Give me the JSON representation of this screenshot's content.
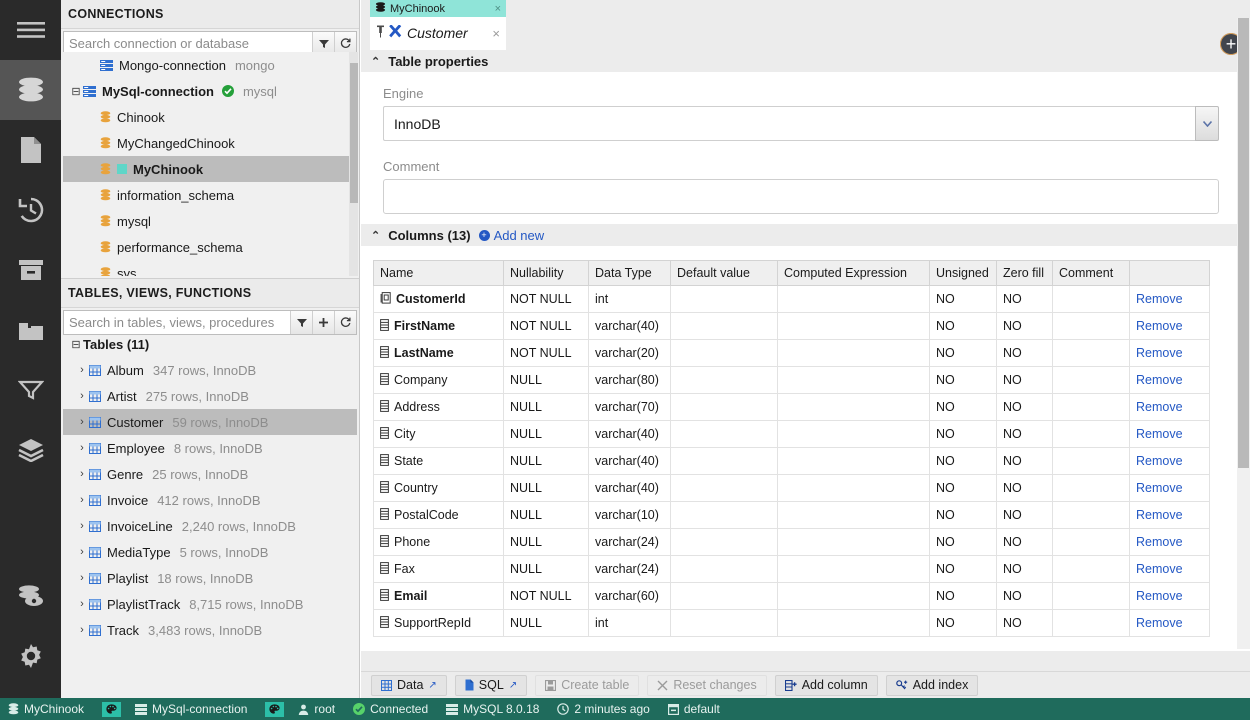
{
  "rail": {
    "items": [
      {
        "name": "menu-icon",
        "label": "Menu",
        "active": false
      },
      {
        "name": "database-icon",
        "label": "Databases",
        "active": true
      },
      {
        "name": "file-icon",
        "label": "Files",
        "active": false
      },
      {
        "name": "history-icon",
        "label": "History",
        "active": false
      },
      {
        "name": "archive-icon",
        "label": "Archive",
        "active": false
      },
      {
        "name": "folder-icon",
        "label": "Saved",
        "active": false
      },
      {
        "name": "funnel-icon",
        "label": "Filters",
        "active": false
      },
      {
        "name": "layers-icon",
        "label": "Layers",
        "active": false
      },
      {
        "name": "db-view-icon",
        "label": "Data preview",
        "active": false
      },
      {
        "name": "gear-icon",
        "label": "Settings",
        "active": false
      }
    ]
  },
  "connections": {
    "title": "CONNECTIONS",
    "search_placeholder": "Search connection or database",
    "search_value": "",
    "filter_icon": "funnel-icon",
    "refresh_icon": "refresh-icon",
    "tree": [
      {
        "indent": 1,
        "twist": "",
        "icon": "server-icon",
        "label": "Mongo-connection",
        "meta": "mongo",
        "bold": false,
        "selected": false,
        "swatch": false
      },
      {
        "indent": 0,
        "twist": "⊟",
        "icon": "server-icon",
        "label": "MySql-connection",
        "meta": "mysql",
        "bold": true,
        "selected": false,
        "swatch": false,
        "status": "connected-check-icon"
      },
      {
        "indent": 1,
        "twist": "",
        "icon": "database-icon",
        "label": "Chinook",
        "meta": "",
        "bold": false,
        "selected": false,
        "swatch": false
      },
      {
        "indent": 1,
        "twist": "",
        "icon": "database-icon",
        "label": "MyChangedChinook",
        "meta": "",
        "bold": false,
        "selected": false,
        "swatch": false
      },
      {
        "indent": 1,
        "twist": "",
        "icon": "database-icon",
        "label": "MyChinook",
        "meta": "",
        "bold": true,
        "selected": true,
        "swatch": true
      },
      {
        "indent": 1,
        "twist": "",
        "icon": "database-icon",
        "label": "information_schema",
        "meta": "",
        "bold": false,
        "selected": false,
        "swatch": false
      },
      {
        "indent": 1,
        "twist": "",
        "icon": "database-icon",
        "label": "mysql",
        "meta": "",
        "bold": false,
        "selected": false,
        "swatch": false
      },
      {
        "indent": 1,
        "twist": "",
        "icon": "database-icon",
        "label": "performance_schema",
        "meta": "",
        "bold": false,
        "selected": false,
        "swatch": false
      },
      {
        "indent": 1,
        "twist": "",
        "icon": "database-icon",
        "label": "sys",
        "meta": "",
        "bold": false,
        "selected": false,
        "swatch": false
      }
    ]
  },
  "tables_panel": {
    "title": "TABLES, VIEWS, FUNCTIONS",
    "search_placeholder": "Search in tables, views, procedures",
    "search_value": "",
    "filter_icon": "funnel-icon",
    "add_icon": "plus-icon",
    "refresh_icon": "refresh-icon",
    "group": {
      "twist": "⊟",
      "label": "Tables (11)"
    },
    "tables": [
      {
        "twist": "›",
        "label": "Album",
        "meta": "347 rows, InnoDB",
        "selected": false
      },
      {
        "twist": "›",
        "label": "Artist",
        "meta": "275 rows, InnoDB",
        "selected": false
      },
      {
        "twist": "›",
        "label": "Customer",
        "meta": "59 rows, InnoDB",
        "selected": true
      },
      {
        "twist": "›",
        "label": "Employee",
        "meta": "8 rows, InnoDB",
        "selected": false
      },
      {
        "twist": "›",
        "label": "Genre",
        "meta": "25 rows, InnoDB",
        "selected": false
      },
      {
        "twist": "›",
        "label": "Invoice",
        "meta": "412 rows, InnoDB",
        "selected": false
      },
      {
        "twist": "›",
        "label": "InvoiceLine",
        "meta": "2,240 rows, InnoDB",
        "selected": false
      },
      {
        "twist": "›",
        "label": "MediaType",
        "meta": "5 rows, InnoDB",
        "selected": false
      },
      {
        "twist": "›",
        "label": "Playlist",
        "meta": "18 rows, InnoDB",
        "selected": false
      },
      {
        "twist": "›",
        "label": "PlaylistTrack",
        "meta": "8,715 rows, InnoDB",
        "selected": false
      },
      {
        "twist": "›",
        "label": "Track",
        "meta": "3,483 rows, InnoDB",
        "selected": false
      }
    ]
  },
  "tabs": {
    "database_tab": {
      "label": "MyChinook",
      "icon": "database-icon",
      "close": "×",
      "active": true
    },
    "object_tab": {
      "label": "Customer",
      "pin_icon": "pin-icon",
      "type_icon": "table-structure-icon",
      "close": "×",
      "active": true
    },
    "add_tab_button": "+"
  },
  "table_properties": {
    "caret": "⌃",
    "title": "Table properties",
    "engine": {
      "label": "Engine",
      "value": "InnoDB",
      "dropdown_icon": "chevron-down-icon"
    },
    "comment": {
      "label": "Comment",
      "value": ""
    }
  },
  "columns_section": {
    "caret": "⌃",
    "title": "Columns (13)",
    "add_new_label": "Add new",
    "headers": [
      "Name",
      "Nullability",
      "Data Type",
      "Default value",
      "Computed Expression",
      "Unsigned",
      "Zero fill",
      "Comment",
      ""
    ],
    "remove_label": "Remove",
    "rows": [
      {
        "icon": "primary-key-icon",
        "name": "CustomerId",
        "bold": true,
        "nullability": "NOT NULL",
        "data_type": "int",
        "default": "",
        "computed": "",
        "unsigned": "NO",
        "zero_fill": "NO",
        "comment": ""
      },
      {
        "icon": "column-icon",
        "name": "FirstName",
        "bold": true,
        "nullability": "NOT NULL",
        "data_type": "varchar(40)",
        "default": "",
        "computed": "",
        "unsigned": "NO",
        "zero_fill": "NO",
        "comment": ""
      },
      {
        "icon": "column-icon",
        "name": "LastName",
        "bold": true,
        "nullability": "NOT NULL",
        "data_type": "varchar(20)",
        "default": "",
        "computed": "",
        "unsigned": "NO",
        "zero_fill": "NO",
        "comment": ""
      },
      {
        "icon": "column-icon",
        "name": "Company",
        "bold": false,
        "nullability": "NULL",
        "data_type": "varchar(80)",
        "default": "",
        "computed": "",
        "unsigned": "NO",
        "zero_fill": "NO",
        "comment": ""
      },
      {
        "icon": "column-icon",
        "name": "Address",
        "bold": false,
        "nullability": "NULL",
        "data_type": "varchar(70)",
        "default": "",
        "computed": "",
        "unsigned": "NO",
        "zero_fill": "NO",
        "comment": ""
      },
      {
        "icon": "column-icon",
        "name": "City",
        "bold": false,
        "nullability": "NULL",
        "data_type": "varchar(40)",
        "default": "",
        "computed": "",
        "unsigned": "NO",
        "zero_fill": "NO",
        "comment": ""
      },
      {
        "icon": "column-icon",
        "name": "State",
        "bold": false,
        "nullability": "NULL",
        "data_type": "varchar(40)",
        "default": "",
        "computed": "",
        "unsigned": "NO",
        "zero_fill": "NO",
        "comment": ""
      },
      {
        "icon": "column-icon",
        "name": "Country",
        "bold": false,
        "nullability": "NULL",
        "data_type": "varchar(40)",
        "default": "",
        "computed": "",
        "unsigned": "NO",
        "zero_fill": "NO",
        "comment": ""
      },
      {
        "icon": "column-icon",
        "name": "PostalCode",
        "bold": false,
        "nullability": "NULL",
        "data_type": "varchar(10)",
        "default": "",
        "computed": "",
        "unsigned": "NO",
        "zero_fill": "NO",
        "comment": ""
      },
      {
        "icon": "column-icon",
        "name": "Phone",
        "bold": false,
        "nullability": "NULL",
        "data_type": "varchar(24)",
        "default": "",
        "computed": "",
        "unsigned": "NO",
        "zero_fill": "NO",
        "comment": ""
      },
      {
        "icon": "column-icon",
        "name": "Fax",
        "bold": false,
        "nullability": "NULL",
        "data_type": "varchar(24)",
        "default": "",
        "computed": "",
        "unsigned": "NO",
        "zero_fill": "NO",
        "comment": ""
      },
      {
        "icon": "column-icon",
        "name": "Email",
        "bold": true,
        "nullability": "NOT NULL",
        "data_type": "varchar(60)",
        "default": "",
        "computed": "",
        "unsigned": "NO",
        "zero_fill": "NO",
        "comment": ""
      },
      {
        "icon": "column-icon",
        "name": "SupportRepId",
        "bold": false,
        "nullability": "NULL",
        "data_type": "int",
        "default": "",
        "computed": "",
        "unsigned": "NO",
        "zero_fill": "NO",
        "comment": ""
      }
    ]
  },
  "toolbar": {
    "buttons": [
      {
        "label": "Data",
        "icon": "grid-icon",
        "external": "↗",
        "disabled": false
      },
      {
        "label": "SQL",
        "icon": "file-icon",
        "external": "↗",
        "disabled": false
      },
      {
        "label": "Create table",
        "icon": "save-icon",
        "external": "",
        "disabled": true
      },
      {
        "label": "Reset changes",
        "icon": "x-icon",
        "external": "",
        "disabled": true
      },
      {
        "label": "Add column",
        "icon": "add-column-icon",
        "external": "",
        "disabled": false
      },
      {
        "label": "Add index",
        "icon": "add-index-icon",
        "external": "",
        "disabled": false
      }
    ]
  },
  "status_bar": {
    "items": [
      {
        "icon": "database-icon",
        "text": "MyChinook",
        "chip_after": true
      },
      {
        "icon": "server-icon",
        "text": "MySql-connection",
        "chip_after": true
      },
      {
        "icon": "user-icon",
        "text": "root",
        "chip_after": false
      },
      {
        "icon": "check-icon",
        "text": "Connected",
        "chip_after": false
      },
      {
        "icon": "server-icon",
        "text": "MySQL 8.0.18",
        "chip_after": false
      },
      {
        "icon": "clock-icon",
        "text": "2 minutes ago",
        "chip_after": false
      },
      {
        "icon": "box-icon",
        "text": "default",
        "chip_after": false
      }
    ]
  },
  "colors": {
    "accent_teal": "#2cbfa8",
    "status_bar": "#1f6b5c",
    "link": "#2458c4",
    "rail": "#2a2a2a",
    "panel": "#f0f0f0"
  }
}
